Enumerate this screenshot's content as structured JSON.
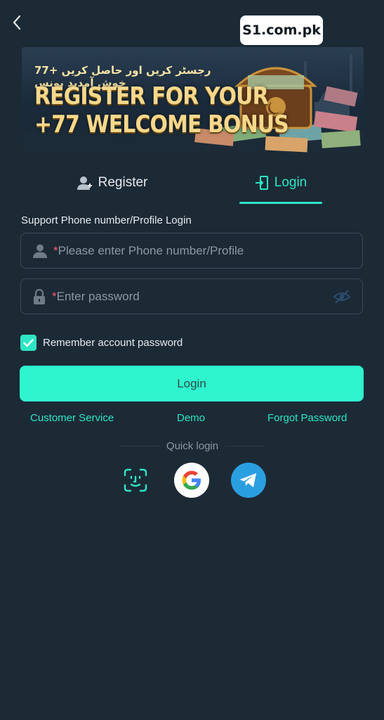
{
  "header": {
    "back_icon": "chevron-left-icon",
    "site_badge": "S1.com.pk"
  },
  "banner": {
    "urdu_text": "رجسٹر کریں اور حاصل کریں +77 خوش آمدید بونس",
    "line1": "REGISTER FOR YOUR",
    "line2": "+77 WELCOME BONUS"
  },
  "tabs": {
    "register": {
      "label": "Register",
      "icon": "user-add-icon"
    },
    "login": {
      "label": "Login",
      "icon": "login-door-icon",
      "active": true
    }
  },
  "form": {
    "section_label": "Support Phone number/Profile Login",
    "phone": {
      "required_mark": "*",
      "placeholder": "Please enter Phone number/Profile",
      "icon": "user-icon"
    },
    "password": {
      "required_mark": "*",
      "placeholder": "Enter password",
      "icon": "lock-icon",
      "toggle_icon": "eye-off-icon"
    },
    "remember": {
      "label": "Remember account password",
      "checked": true
    },
    "submit_label": "Login"
  },
  "links": {
    "customer_service": "Customer Service",
    "demo": "Demo",
    "forgot_password": "Forgot Password"
  },
  "quick_login": {
    "label": "Quick login",
    "options": [
      "face-id-icon",
      "google-icon",
      "telegram-icon"
    ]
  },
  "colors": {
    "background": "#1c2a36",
    "accent": "#2ee6c4",
    "button": "#2ff5cf",
    "required": "#ff5a6e"
  }
}
